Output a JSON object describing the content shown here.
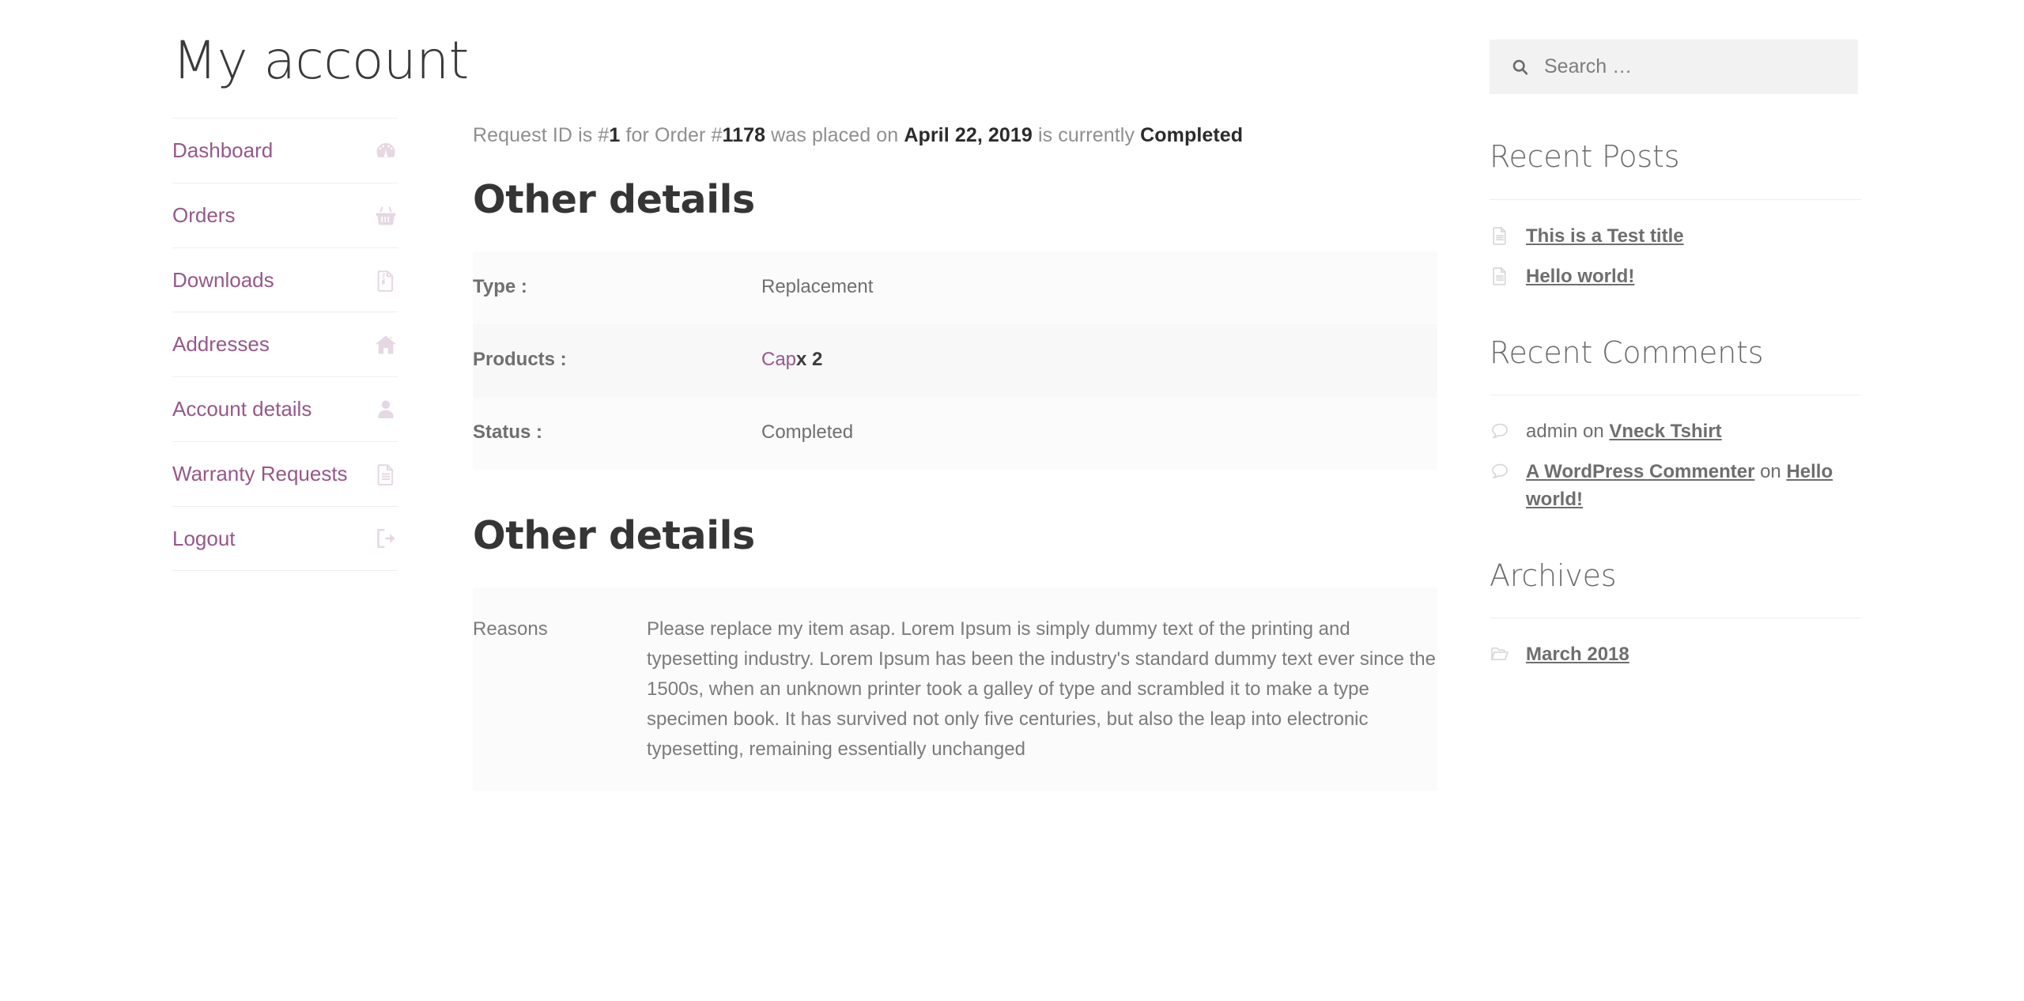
{
  "page": {
    "title": "My account"
  },
  "account_nav": {
    "items": [
      {
        "label": "Dashboard",
        "icon": "dashboard-gauge-icon"
      },
      {
        "label": "Orders",
        "icon": "basket-icon"
      },
      {
        "label": "Downloads",
        "icon": "download-file-icon"
      },
      {
        "label": "Addresses",
        "icon": "home-icon"
      },
      {
        "label": "Account details",
        "icon": "user-icon"
      },
      {
        "label": "Warranty Requests",
        "icon": "document-icon"
      },
      {
        "label": "Logout",
        "icon": "logout-arrow-icon"
      }
    ]
  },
  "request": {
    "prefix": "Request ID is #",
    "request_id": "1",
    "middle": " for Order #",
    "order_id": "1178",
    "placed_text": " was placed on ",
    "date": "April 22, 2019",
    "currently_text": " is currently ",
    "status": "Completed"
  },
  "details_section": {
    "heading": "Other details",
    "rows": [
      {
        "label": "Type :",
        "value": "Replacement",
        "link": null,
        "qty": null
      },
      {
        "label": "Products :",
        "value": "",
        "link": "Cap",
        "qty": "x 2"
      },
      {
        "label": "Status :",
        "value": "Completed",
        "link": null,
        "qty": null
      }
    ]
  },
  "reasons_section": {
    "heading": "Other details",
    "label": "Reasons",
    "text": "Please replace my item asap. Lorem Ipsum is simply dummy text of the printing and typesetting industry. Lorem Ipsum has been the industry's standard dummy text ever since the 1500s, when an unknown printer took a galley of type and scrambled it to make a type specimen book. It has survived not only five centuries, but also the leap into electronic typesetting, remaining essentially unchanged"
  },
  "sidebar": {
    "search": {
      "placeholder": "Search …",
      "value": "",
      "icon": "search-icon"
    },
    "recent_posts": {
      "title": "Recent Posts",
      "items": [
        {
          "link": "This is a Test title",
          "icon": "document-icon"
        },
        {
          "link": "Hello world!",
          "icon": "document-icon"
        }
      ]
    },
    "recent_comments": {
      "title": "Recent Comments",
      "items": [
        {
          "author": "admin",
          "author_link": false,
          "on": " on ",
          "post": "Vneck Tshirt",
          "icon": "comment-icon"
        },
        {
          "author": "A WordPress Commenter",
          "author_link": true,
          "on": " on ",
          "post": "Hello world!",
          "icon": "comment-icon"
        }
      ]
    },
    "archives": {
      "title": "Archives",
      "items": [
        {
          "link": "March 2018",
          "icon": "folder-icon"
        }
      ]
    }
  },
  "colors": {
    "accent_purple": "#96588a",
    "icon_tint": "#e5d7e3",
    "heading_gray": "#353535",
    "body_gray": "#7b7b7b",
    "table_row_bg": "#fbfbfb",
    "table_row_alt_bg": "#f8f8f8",
    "search_bg": "#f2f2f2"
  }
}
